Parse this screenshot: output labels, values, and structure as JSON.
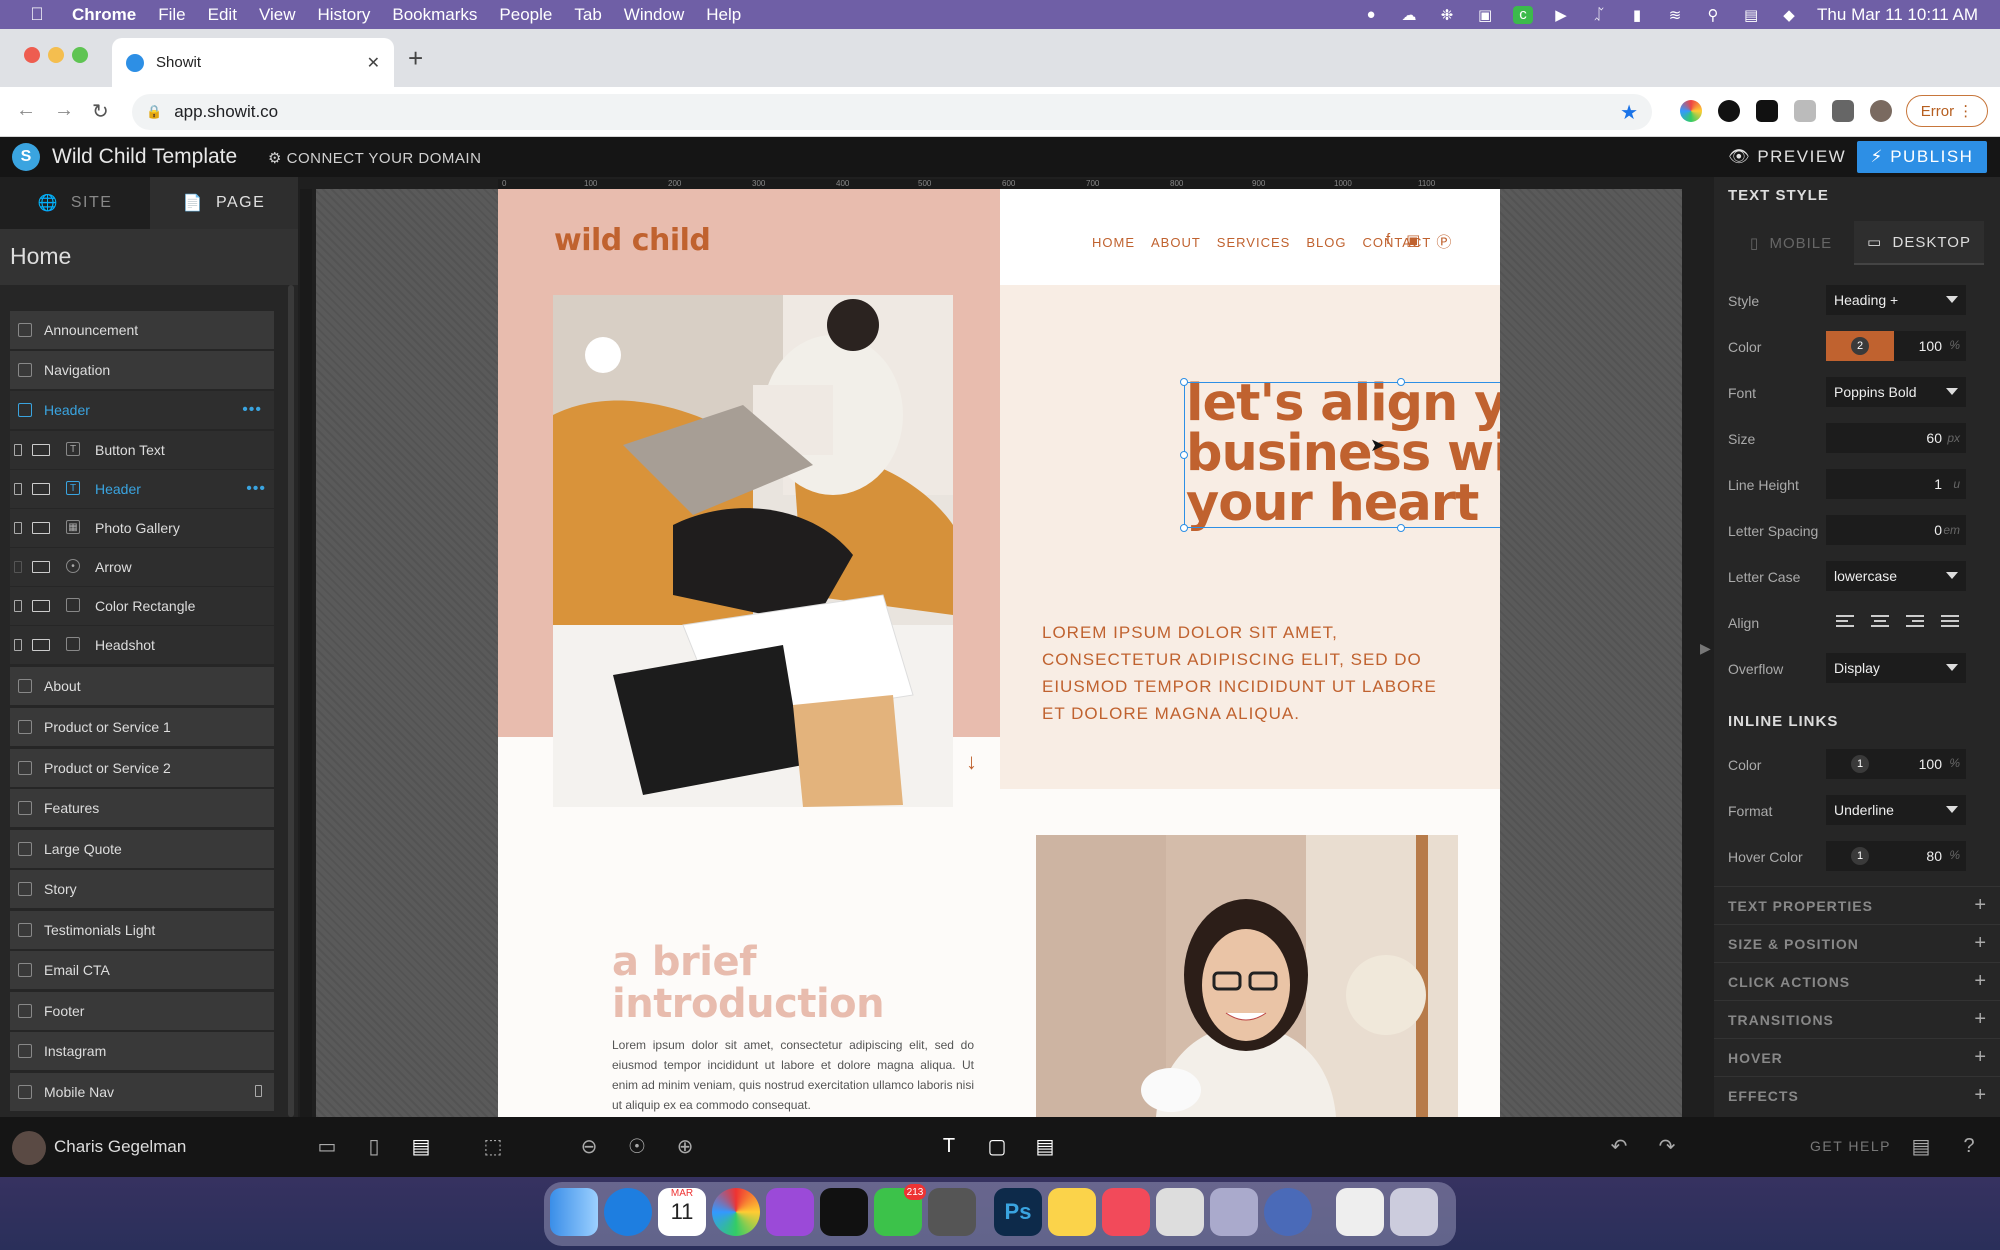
{
  "menubar": {
    "app_name": "Chrome",
    "items": [
      "File",
      "Edit",
      "View",
      "History",
      "Bookmarks",
      "People",
      "Tab",
      "Window",
      "Help"
    ],
    "datetime": "Thu Mar 11  10:11 AM"
  },
  "browser": {
    "tab_title": "Showit",
    "url": "app.showit.co",
    "error_label": "Error"
  },
  "app": {
    "site_title": "Wild Child Template",
    "connect_domain": "CONNECT YOUR DOMAIN",
    "preview_label": "PREVIEW",
    "publish_label": "PUBLISH"
  },
  "left_panel": {
    "tab_site": "SITE",
    "tab_page": "PAGE",
    "page_name": "Home",
    "sections_before": [
      "Announcement",
      "Navigation"
    ],
    "active_section": "Header",
    "header_children": [
      "Button Text",
      "Header",
      "Photo Gallery",
      "Arrow",
      "Color Rectangle",
      "Headshot"
    ],
    "sections_after": [
      "About",
      "Product or Service 1",
      "Product or Service 2",
      "Features",
      "Large Quote",
      "Story",
      "Testimonials Light",
      "Email CTA",
      "Footer",
      "Instagram",
      "Mobile Nav"
    ]
  },
  "ruler": {
    "ticks": [
      "0",
      "100",
      "200",
      "300",
      "400",
      "500",
      "600",
      "700",
      "800",
      "900",
      "1000",
      "1100"
    ]
  },
  "site": {
    "brand": "wild child",
    "nav": [
      "HOME",
      "ABOUT",
      "SERVICES",
      "BLOG",
      "CONTACT"
    ],
    "headline": "let's align your business with your heart",
    "lorem_upper": "LOREM IPSUM DOLOR SIT AMET, CONSECTETUR ADIPISCING ELIT, SED DO EIUSMOD TEMPOR INCIDIDUNT UT LABORE ET DOLORE MAGNA ALIQUA.",
    "intro_title_1": "a brief",
    "intro_title_2": "introduction",
    "intro_body": "Lorem ipsum dolor sit amet, consectetur adipiscing elit, sed do eiusmod tempor incididunt ut labore et dolore magna aliqua. Ut enim ad minim veniam, quis nostrud exercitation ullamco laboris nisi ut aliquip ex ea commodo consequat."
  },
  "right_panel": {
    "text_style": "TEXT STYLE",
    "mobile": "MOBILE",
    "desktop": "DESKTOP",
    "style_label": "Style",
    "style_value": "Heading +",
    "color_label": "Color",
    "color_swatch": "2",
    "color_pct": "100",
    "font_label": "Font",
    "font_value": "Poppins Bold",
    "size_label": "Size",
    "size_value": "60",
    "size_unit": "px",
    "lh_label": "Line Height",
    "lh_value": "1",
    "lh_unit": "u",
    "ls_label": "Letter Spacing",
    "ls_value": "0",
    "ls_unit": "em",
    "case_label": "Letter Case",
    "case_value": "lowercase",
    "align_label": "Align",
    "overflow_label": "Overflow",
    "overflow_value": "Display",
    "inline_links": "INLINE LINKS",
    "il_color_label": "Color",
    "il_color_swatch": "1",
    "il_color_pct": "100",
    "format_label": "Format",
    "format_value": "Underline",
    "hover_label": "Hover Color",
    "hover_swatch": "1",
    "hover_pct": "80",
    "pct_unit": "%",
    "collapsed": [
      "TEXT PROPERTIES",
      "SIZE & POSITION",
      "CLICK ACTIONS",
      "TRANSITIONS",
      "HOVER",
      "EFFECTS"
    ]
  },
  "bottom": {
    "username": "Charis Gegelman",
    "get_help": "GET HELP"
  },
  "dock": {
    "calendar_month": "MAR",
    "calendar_day": "11",
    "messages_badge": "213"
  },
  "colors": {
    "accent": "#2d8fe5",
    "brand_orange": "#c0622f",
    "brand_pink": "#e8bcae",
    "cream": "#f8ede4"
  }
}
